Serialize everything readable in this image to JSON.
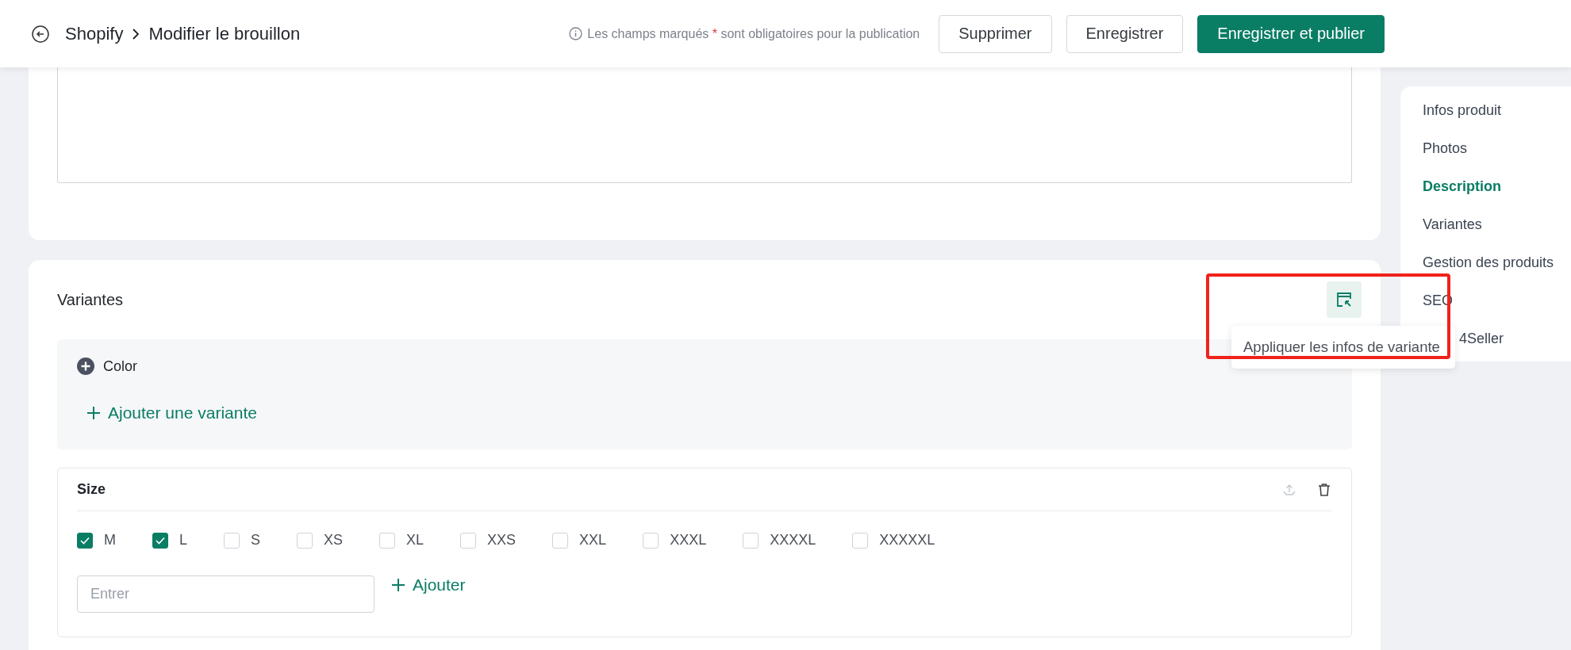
{
  "header": {
    "breadcrumb": [
      "Shopify",
      "Modifier le brouillon"
    ],
    "notice": {
      "before": "Les champs marqués",
      "mark": "*",
      "after": "sont obligatoires pour la publication"
    },
    "buttons": [
      {
        "label": "Supprimer",
        "kind": "secondary"
      },
      {
        "label": "Enregistrer",
        "kind": "secondary"
      },
      {
        "label": "Enregistrer et publier",
        "kind": "primary"
      }
    ]
  },
  "variants_section": {
    "title": "Variantes",
    "apply_tooltip": "Appliquer les infos de variante",
    "options": [
      {
        "kind": "collapsed",
        "name": "Color",
        "add_label": "Ajouter une variante"
      },
      {
        "kind": "expanded",
        "name": "Size",
        "values": [
          {
            "label": "M",
            "checked": true
          },
          {
            "label": "L",
            "checked": true
          },
          {
            "label": "S",
            "checked": false
          },
          {
            "label": "XS",
            "checked": false
          },
          {
            "label": "XL",
            "checked": false
          },
          {
            "label": "XXS",
            "checked": false
          },
          {
            "label": "XXL",
            "checked": false
          },
          {
            "label": "XXXL",
            "checked": false
          },
          {
            "label": "XXXXL",
            "checked": false
          },
          {
            "label": "XXXXXL",
            "checked": false
          }
        ],
        "input_placeholder": "Entrer",
        "add_label": "Ajouter"
      }
    ]
  },
  "sidebar": {
    "items": [
      {
        "label": "Infos produit",
        "selected": false
      },
      {
        "label": "Photos",
        "selected": false
      },
      {
        "label": "Description",
        "selected": true
      },
      {
        "label": "Variantes",
        "selected": false
      },
      {
        "label": "Gestion des produits",
        "selected": false
      },
      {
        "label": "SEO",
        "selected": false
      },
      {
        "label": "4Seller",
        "selected": false,
        "partly_hidden": true
      }
    ]
  }
}
